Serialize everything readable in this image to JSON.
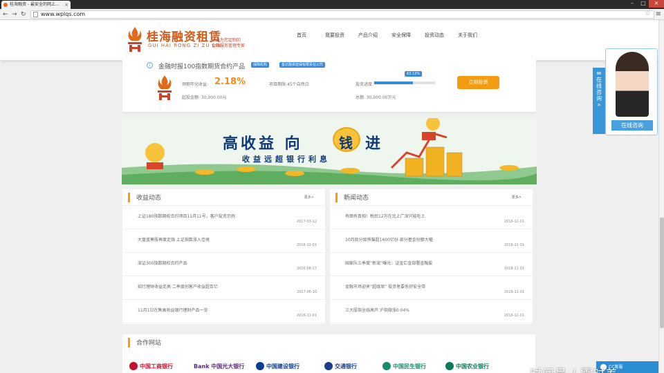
{
  "browser": {
    "tab_title": "桂海融资 - 最安全的网上…",
    "url": "www.wplqs.com"
  },
  "site": {
    "logo_name": "桂海融资租赁",
    "logo_pinyin": "GUI HAI RONG ZI ZU LIN",
    "slogan_line1": "贴身为您定制的",
    "slogan_line2": "金融服务管理专家",
    "nav": [
      "首页",
      "我要投资",
      "产品介绍",
      "安全保障",
      "投资动态",
      "关于我们"
    ]
  },
  "product": {
    "title": "金融时报100指数期货合约产品",
    "badge1": "保障机构",
    "badge2": "金达融资担保有限责任公司",
    "rate_label": "预期年化收益:",
    "rate": "2.18%",
    "min_label": "起投金额: 30,000.00元",
    "term_label": "项目期限:45个自然日",
    "progress_label": "投资进度:",
    "progress_pct": "63.13%",
    "progress_value": 0.6313,
    "total_label": "总额: 30,000.00万元",
    "invest_btn": "立刻投资"
  },
  "banner": {
    "headline_a": "高收益 向",
    "headline_money": "钱",
    "headline_b": "进",
    "subline": "收益远超银行利息"
  },
  "earnings": {
    "title": "收益动态",
    "more": "更多>",
    "items": [
      {
        "text": "上证180指数期权合约项目11月11号，客户投资示例",
        "date": "2017-03-12"
      },
      {
        "text": "大盘蓝筹股再度走强 上证指数涨入佳境",
        "date": "2016-12-01"
      },
      {
        "text": "深证300指数期权合约产品",
        "date": "2016-08-17"
      },
      {
        "text": "招行理财收益走高 二季度创客户收益超百亿",
        "date": "2017-06-10"
      },
      {
        "text": "11月1日在售高收益银行理财产品一览",
        "date": "2016-11-01"
      }
    ]
  },
  "news": {
    "title": "新闻动态",
    "more": "更多>",
    "items": [
      {
        "text": "有图有真相！税后12万在北上广深只能吃土",
        "date": "2016-11-01"
      },
      {
        "text": "10月底分级熊猫超1600亿份 部分基金份额大幅",
        "date": "2016-11-01"
      },
      {
        "text": "国家队三季度“新宠”曝光：证金汇金部署金融股",
        "date": "2016-11-01"
      },
      {
        "text": "金融市场迎来“超级周” 投资者要系好安全带",
        "date": "2016-11-01"
      },
      {
        "text": "三大股指全线高开 沪指微涨0.04%",
        "date": "2016-11-01"
      }
    ]
  },
  "partners": {
    "title": "合作网站",
    "banks": [
      "中国工商银行",
      "Bank 中国光大银行",
      "中国建设银行",
      "交通银行",
      "中国民生银行",
      "中国农业银行"
    ]
  },
  "float": {
    "tab_text": "在线咨询",
    "button": "在线咨询"
  },
  "cc": {
    "label": "CC客服"
  },
  "watermark": "时间号 / 零时差",
  "colors": {
    "accent": "#f39c12",
    "brand": "#d05a18",
    "link": "#3a8ad6"
  }
}
